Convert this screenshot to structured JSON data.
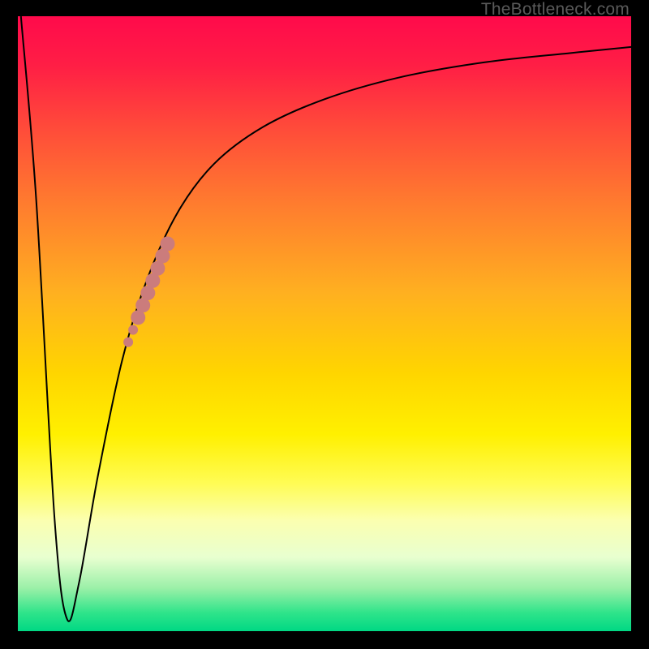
{
  "watermark": "TheBottleneck.com",
  "chart_data": {
    "type": "line",
    "title": "",
    "xlabel": "",
    "ylabel": "",
    "xlim": [
      0,
      100
    ],
    "ylim": [
      0,
      100
    ],
    "grid": false,
    "legend": false,
    "series": [
      {
        "name": "bottleneck-curve",
        "x": [
          0.5,
          3,
          6,
          8,
          10,
          13,
          17,
          21,
          26,
          32,
          40,
          50,
          62,
          76,
          90,
          100
        ],
        "values": [
          100,
          70,
          18,
          2,
          8,
          25,
          44,
          57,
          68,
          76,
          82,
          86.5,
          90,
          92.5,
          94,
          95
        ]
      }
    ],
    "markers": {
      "name": "highlighted-range",
      "color": "#cb7c7c",
      "points": [
        {
          "x": 18.0,
          "y": 47
        },
        {
          "x": 18.8,
          "y": 49
        },
        {
          "x": 19.6,
          "y": 51
        },
        {
          "x": 20.4,
          "y": 53
        },
        {
          "x": 21.2,
          "y": 55
        },
        {
          "x": 22.0,
          "y": 57
        },
        {
          "x": 22.8,
          "y": 59
        },
        {
          "x": 23.6,
          "y": 61
        },
        {
          "x": 24.4,
          "y": 63
        }
      ],
      "radius_small": 6,
      "radius_large": 9
    },
    "background_gradient": {
      "top": "#ff0a4b",
      "mid": "#ffe000",
      "bottom": "#00d884"
    }
  }
}
